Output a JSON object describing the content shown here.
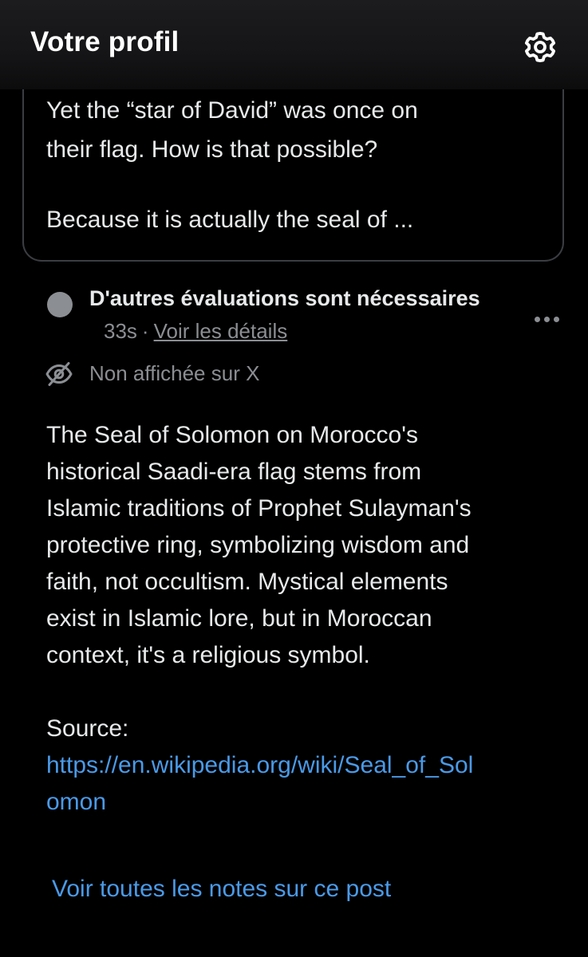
{
  "header": {
    "title": "Votre profil",
    "settings_icon": "gear-icon"
  },
  "post_excerpt": {
    "lines": [
      "Yet the “star of David” was once on",
      "their flag. How is that possible?",
      "Because it is actually the seal of ..."
    ]
  },
  "note_status": {
    "status_icon": "gray-dot",
    "title": "D'autres évaluations sont nécessaires",
    "time": "33s",
    "separator": "·",
    "details_link": "Voir les détails",
    "more_icon": "more-dots-icon",
    "visibility_icon": "eye-slash-icon",
    "visibility_label": "Non affichée sur X"
  },
  "note_body": {
    "lines": [
      "The Seal of Solomon on Morocco's",
      "historical Saadi-era flag stems from",
      "Islamic traditions of Prophet Sulayman's",
      "protective ring, symbolizing wisdom and",
      "faith, not occultism. Mystical elements",
      "exist in Islamic lore, but in Moroccan",
      "context, it's a religious symbol."
    ],
    "source_label": "Source:",
    "source_url_lines": [
      "https://en.wikipedia.org/wiki/Seal_of_Sol",
      "omon"
    ]
  },
  "footer": {
    "all_notes_link": "Voir toutes les notes sur ce post"
  },
  "colors": {
    "background": "#000000",
    "text": "#e7e9ea",
    "muted": "#8b8e92",
    "link": "#4a9ae8",
    "border": "#3a3d41"
  }
}
